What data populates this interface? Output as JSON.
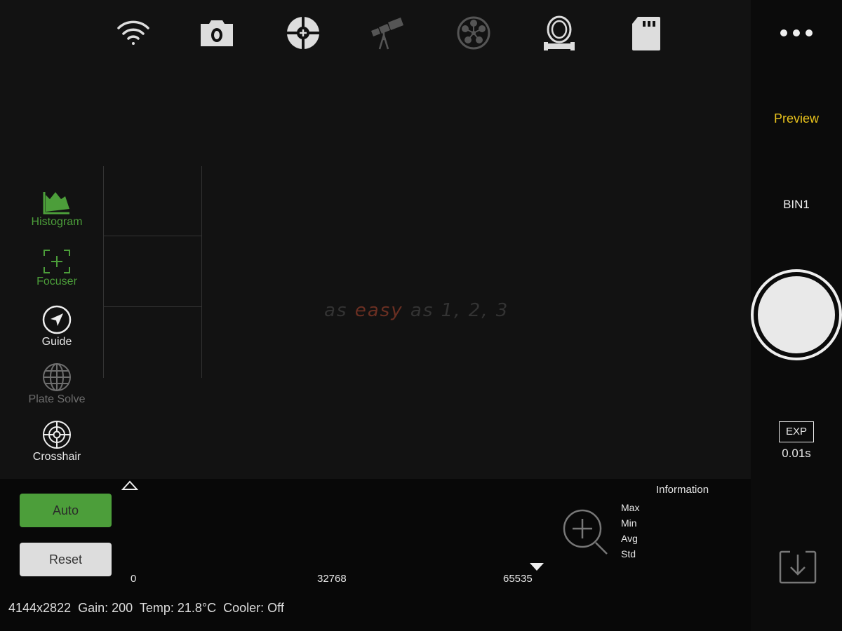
{
  "toolbar": {
    "icons": [
      "wifi-icon",
      "camera-icon",
      "guide-target-icon",
      "telescope-icon",
      "filter-wheel-icon",
      "focuser-icon",
      "sd-card-icon"
    ]
  },
  "watermark": {
    "w1": "as",
    "w2": "easy",
    "w3": "as 1, 2, 3",
    "accent": "#7a3a2a"
  },
  "sidebar": {
    "items": [
      {
        "label": "Histogram",
        "icon": "histogram-icon",
        "state": "active"
      },
      {
        "label": "Focuser",
        "icon": "focus-frame-icon",
        "state": "active"
      },
      {
        "label": "Guide",
        "icon": "navigation-icon",
        "state": "enabled"
      },
      {
        "label": "Plate Solve",
        "icon": "globe-icon",
        "state": "disabled"
      },
      {
        "label": "Crosshair",
        "icon": "crosshair-icon",
        "state": "enabled"
      }
    ]
  },
  "right": {
    "mode": "Preview",
    "bin": "BIN1",
    "exp_label": "EXP",
    "exp_value": "0.01s",
    "more": "more-icon"
  },
  "histogram": {
    "auto": "Auto",
    "reset": "Reset",
    "ticks": [
      "0",
      "32768",
      "65535"
    ]
  },
  "info": {
    "title": "Information",
    "rows": [
      "Max",
      "Min",
      "Avg",
      "Std"
    ]
  },
  "status": {
    "resolution": "4144x2822",
    "gain": "Gain: 200",
    "temp": "Temp: 21.8°C",
    "cooler": "Cooler: Off"
  },
  "colors": {
    "accent_green": "#4c9e3a",
    "preview_yellow": "#e8c21c"
  }
}
